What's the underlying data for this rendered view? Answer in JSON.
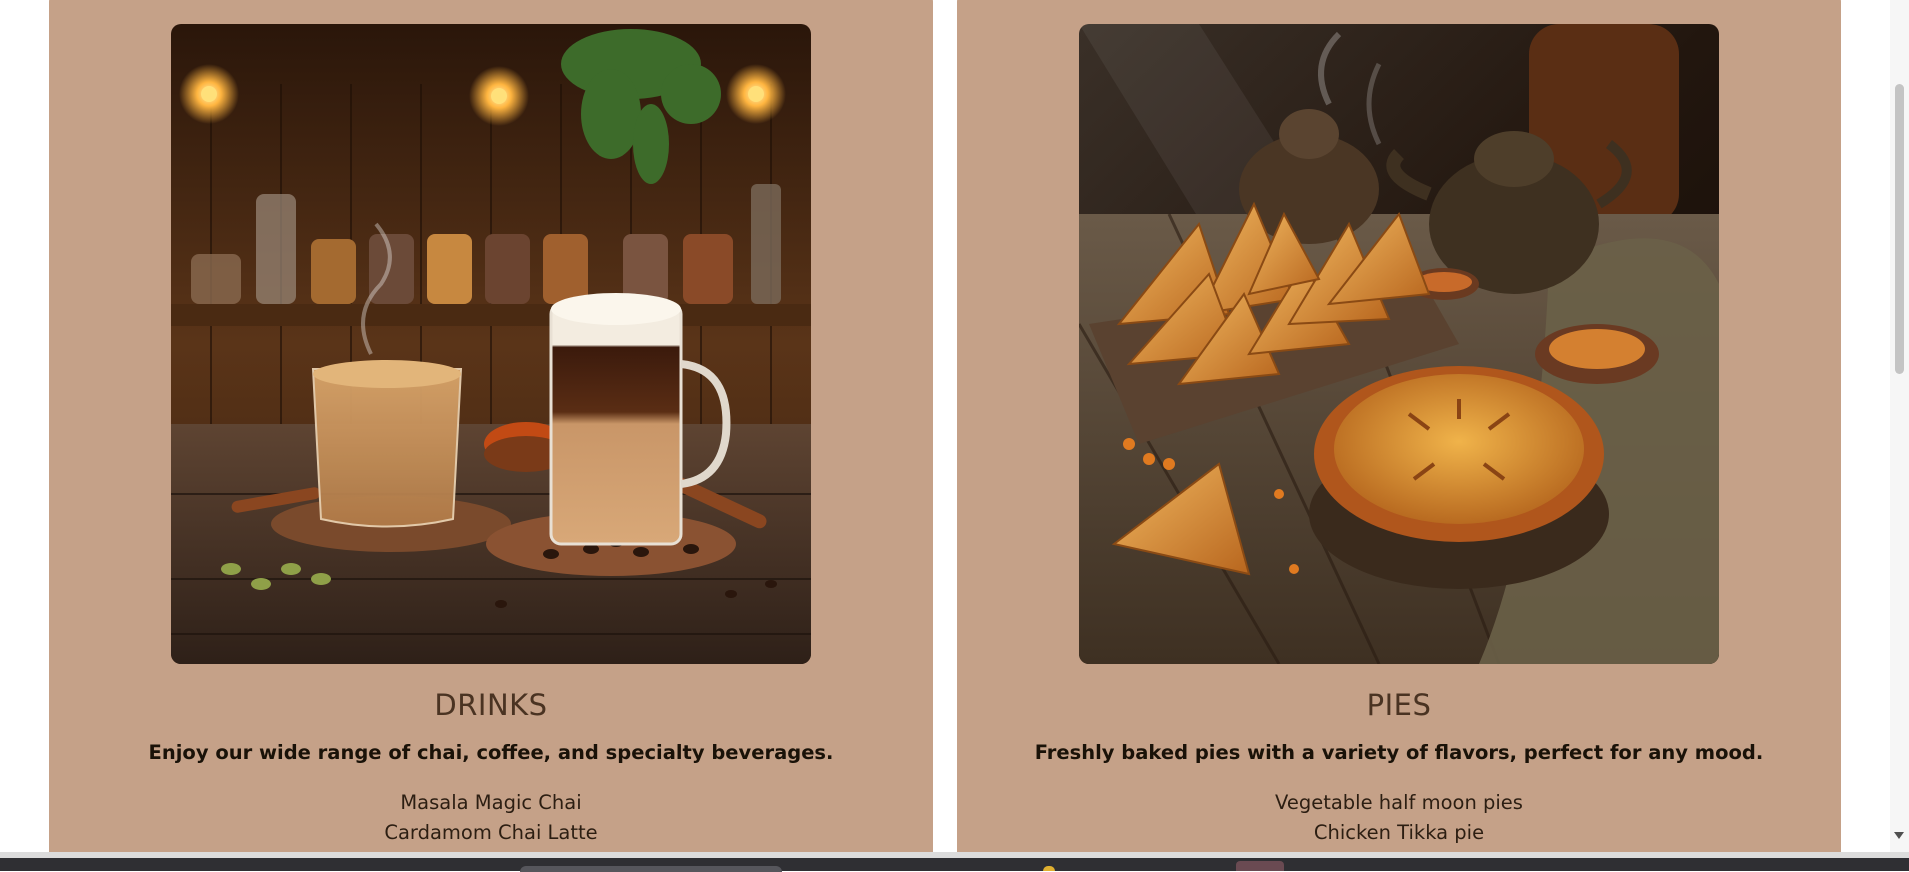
{
  "cards": [
    {
      "image_alt": "Chai latte and coffee on a rustic wooden table",
      "title": "DRINKS",
      "description": "Enjoy our wide range of chai, coffee, and specialty beverages.",
      "items": [
        "Masala Magic Chai",
        "Cardamom Chai Latte"
      ]
    },
    {
      "image_alt": "Samosas, a baked pie and a teapot on a wooden board",
      "title": "PIES",
      "description": "Freshly baked pies with a variety of flavors, perfect for any mood.",
      "items": [
        "Vegetable half moon pies",
        "Chicken Tikka pie"
      ]
    }
  ],
  "colors": {
    "card_background": "#c5a188",
    "title_color": "#4a3322",
    "page_background": "#ffffff"
  },
  "scrollbar": {
    "position": 0.15
  }
}
